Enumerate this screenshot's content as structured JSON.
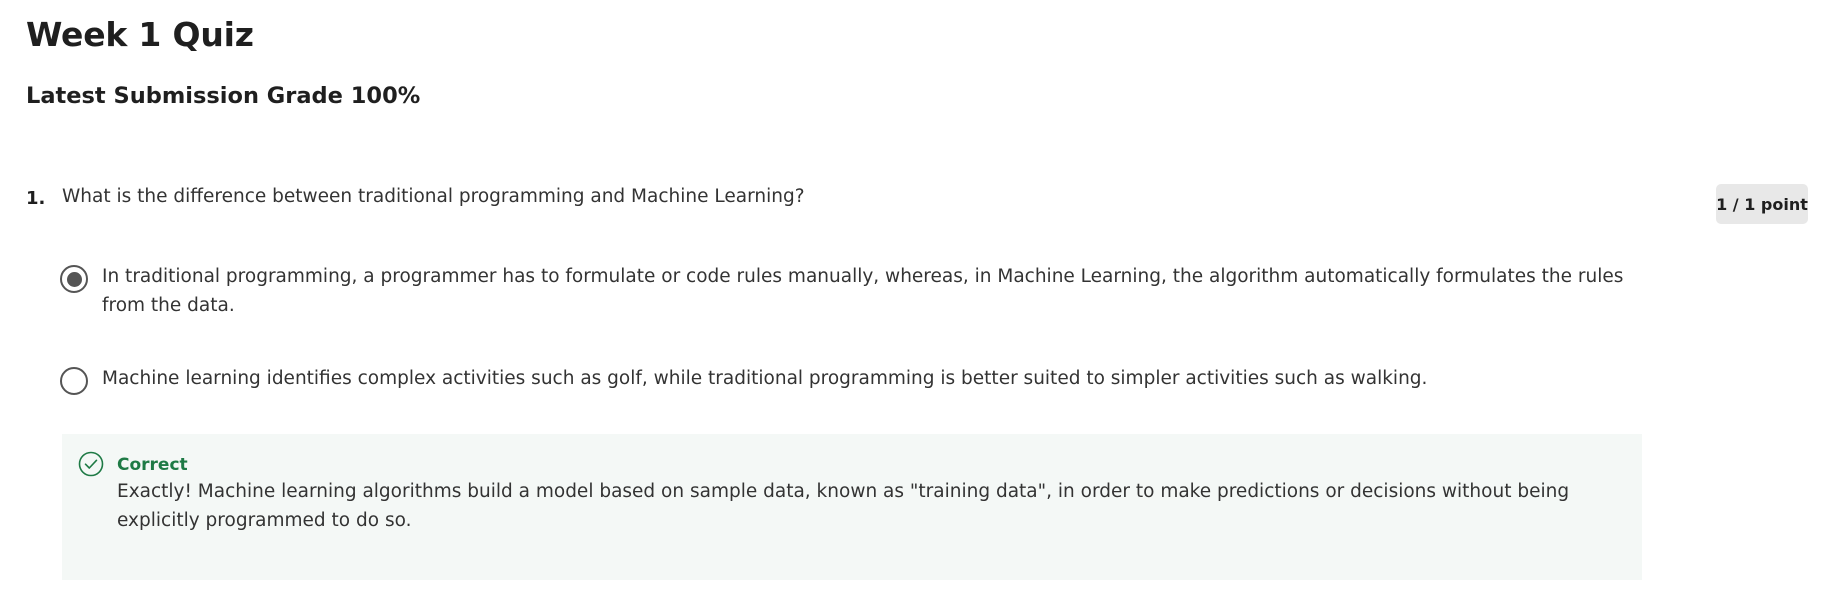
{
  "quiz": {
    "title": "Week 1 Quiz",
    "grade_line": "Latest Submission Grade 100%"
  },
  "question": {
    "number": "1.",
    "text": "What is the difference between traditional programming and Machine Learning?",
    "points": "1 / 1 point",
    "options": [
      {
        "text": "In traditional programming, a programmer has to formulate or code rules manually, whereas, in Machine Learning, the algorithm automatically formulates the rules from the data.",
        "selected": true
      },
      {
        "text": "Machine learning identifies complex activities such as golf, while traditional programming is better suited to simpler activities such as walking.",
        "selected": false
      }
    ],
    "feedback": {
      "status": "Correct",
      "icon": "check-circle-icon",
      "text": "Exactly! Machine learning algorithms build a model based on sample data, known as \"training data\", in order to make predictions or decisions without being explicitly programmed to do so."
    }
  },
  "colors": {
    "correct_green": "#1e7a45",
    "feedback_bg": "#f4f8f6",
    "badge_bg": "#e8e8e8",
    "radio_gray": "#555555"
  }
}
